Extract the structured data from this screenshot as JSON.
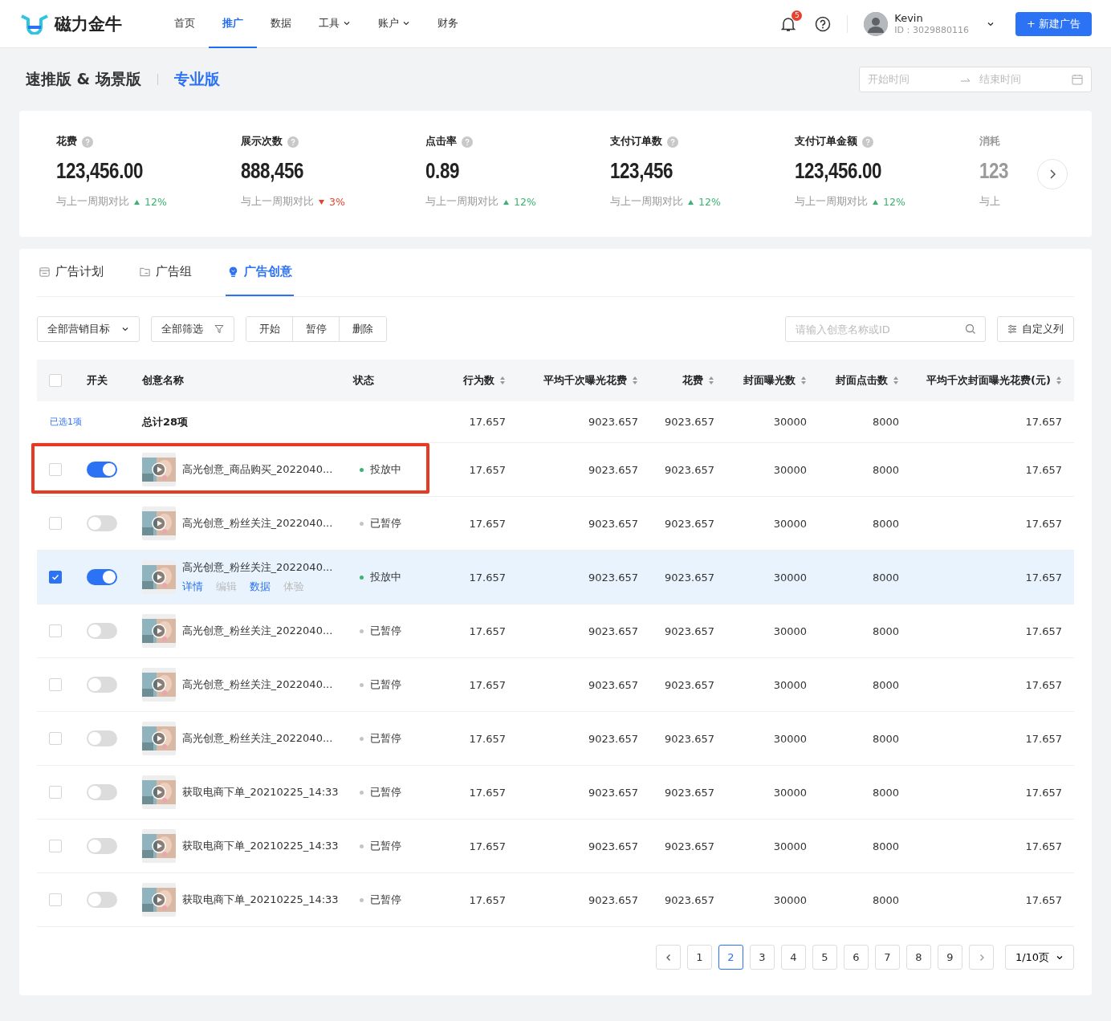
{
  "header": {
    "logo": "磁力金牛",
    "nav": [
      {
        "label": "首页",
        "selected": false,
        "dropdown": false
      },
      {
        "label": "推广",
        "selected": true,
        "dropdown": false
      },
      {
        "label": "数据",
        "selected": false,
        "dropdown": false
      },
      {
        "label": "工具",
        "selected": false,
        "dropdown": true
      },
      {
        "label": "账户",
        "selected": false,
        "dropdown": true
      },
      {
        "label": "财务",
        "selected": false,
        "dropdown": false
      }
    ],
    "notification_count": "5",
    "user": {
      "name": "Kevin",
      "id": "ID：3029880116"
    },
    "create_button": "+ 新建广告"
  },
  "subheader": {
    "versions": [
      {
        "label": "速推版 & 场景版",
        "selected": false
      },
      {
        "label": "专业版",
        "selected": true
      }
    ],
    "date_range": {
      "start_placeholder": "开始时间",
      "end_placeholder": "结束时间"
    }
  },
  "metrics": [
    {
      "label": "花费",
      "value": "123,456.00",
      "compare": "与上一周期对比",
      "change": "12%",
      "rising": true,
      "faded": false
    },
    {
      "label": "展示次数",
      "value": "888,456",
      "compare": "与上一周期对比",
      "change": "3%",
      "rising": false,
      "faded": false
    },
    {
      "label": "点击率",
      "value": "0.89",
      "compare": "与上一周期对比",
      "change": "12%",
      "rising": true,
      "faded": false
    },
    {
      "label": "支付订单数",
      "value": "123,456",
      "compare": "与上一周期对比",
      "change": "12%",
      "rising": true,
      "faded": false
    },
    {
      "label": "支付订单金额",
      "value": "123,456.00",
      "compare": "与上一周期对比",
      "change": "12%",
      "rising": true,
      "faded": false
    },
    {
      "label": "消耗",
      "value": "123",
      "compare": "与上",
      "faded": true
    }
  ],
  "tabs": [
    {
      "label": "广告计划",
      "kind": "plan",
      "selected": false
    },
    {
      "label": "广告组",
      "kind": "group",
      "selected": false
    },
    {
      "label": "广告创意",
      "kind": "creative",
      "selected": true
    }
  ],
  "toolbar": {
    "goal_select": "全部营销目标",
    "filter": "全部筛选",
    "actions": [
      "开始",
      "暂停",
      "删除"
    ],
    "search_placeholder": "请输入创意名称或ID",
    "customize": "自定义列"
  },
  "table": {
    "select_all_checked": false,
    "columns": [
      {
        "label": "开关",
        "sortable": false
      },
      {
        "label": "创意名称",
        "sortable": false
      },
      {
        "label": "状态",
        "sortable": false
      },
      {
        "label": "行为数",
        "sortable": true
      },
      {
        "label": "平均千次曝光花费",
        "sortable": true
      },
      {
        "label": "花费",
        "sortable": true
      },
      {
        "label": "封面曝光数",
        "sortable": true
      },
      {
        "label": "封面点击数",
        "sortable": true
      },
      {
        "label": "平均千次封面曝光花费(元)",
        "sortable": true
      }
    ],
    "summary": {
      "selected_count": "已选1项",
      "total": "总计28项",
      "values": [
        "17.657",
        "9023.657",
        "9023.657",
        "30000",
        "8000",
        "17.657"
      ]
    },
    "rows": [
      {
        "selected": false,
        "on": true,
        "highlighted": true,
        "name": "高光创意_商品购买_2022040...",
        "status": "投放中",
        "active": true,
        "values": [
          "17.657",
          "9023.657",
          "9023.657",
          "30000",
          "8000",
          "17.657"
        ]
      },
      {
        "selected": false,
        "on": false,
        "highlighted": false,
        "name": "高光创意_粉丝关注_2022040...",
        "status": "已暂停",
        "active": false,
        "values": [
          "17.657",
          "9023.657",
          "9023.657",
          "30000",
          "8000",
          "17.657"
        ]
      },
      {
        "selected": true,
        "on": true,
        "highlighted": false,
        "name": "高光创意_粉丝关注_2022040...",
        "status": "投放中",
        "active": true,
        "actions": [
          {
            "label": "详情",
            "disabled": false
          },
          {
            "label": "编辑",
            "disabled": true
          },
          {
            "label": "数据",
            "disabled": false
          },
          {
            "label": "体验",
            "disabled": true
          }
        ],
        "values": [
          "17.657",
          "9023.657",
          "9023.657",
          "30000",
          "8000",
          "17.657"
        ]
      },
      {
        "selected": false,
        "on": false,
        "highlighted": false,
        "name": "高光创意_粉丝关注_2022040...",
        "status": "已暂停",
        "active": false,
        "values": [
          "17.657",
          "9023.657",
          "9023.657",
          "30000",
          "8000",
          "17.657"
        ]
      },
      {
        "selected": false,
        "on": false,
        "highlighted": false,
        "name": "高光创意_粉丝关注_2022040...",
        "status": "已暂停",
        "active": false,
        "values": [
          "17.657",
          "9023.657",
          "9023.657",
          "30000",
          "8000",
          "17.657"
        ]
      },
      {
        "selected": false,
        "on": false,
        "highlighted": false,
        "name": "高光创意_粉丝关注_2022040...",
        "status": "已暂停",
        "active": false,
        "values": [
          "17.657",
          "9023.657",
          "9023.657",
          "30000",
          "8000",
          "17.657"
        ]
      },
      {
        "selected": false,
        "on": false,
        "highlighted": false,
        "name": "获取电商下单_20210225_14:33",
        "status": "已暂停",
        "active": false,
        "values": [
          "17.657",
          "9023.657",
          "9023.657",
          "30000",
          "8000",
          "17.657"
        ]
      },
      {
        "selected": false,
        "on": false,
        "highlighted": false,
        "name": "获取电商下单_20210225_14:33",
        "status": "已暂停",
        "active": false,
        "values": [
          "17.657",
          "9023.657",
          "9023.657",
          "30000",
          "8000",
          "17.657"
        ]
      },
      {
        "selected": false,
        "on": false,
        "highlighted": false,
        "name": "获取电商下单_20210225_14:33",
        "status": "已暂停",
        "active": false,
        "values": [
          "17.657",
          "9023.657",
          "9023.657",
          "30000",
          "8000",
          "17.657"
        ]
      }
    ]
  },
  "pagination": {
    "pages": [
      {
        "label": "1",
        "selected": false
      },
      {
        "label": "2",
        "selected": true
      },
      {
        "label": "3",
        "selected": false
      },
      {
        "label": "4",
        "selected": false
      },
      {
        "label": "5",
        "selected": false
      },
      {
        "label": "6",
        "selected": false
      },
      {
        "label": "7",
        "selected": false
      },
      {
        "label": "8",
        "selected": false
      },
      {
        "label": "9",
        "selected": false
      }
    ],
    "page_size": "1/10页"
  }
}
